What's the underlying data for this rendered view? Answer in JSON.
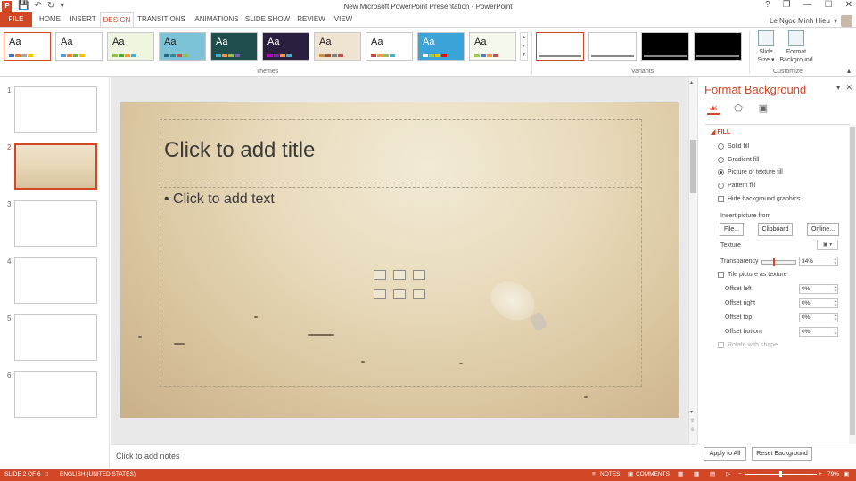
{
  "app": {
    "window_title": "New Microsoft PowerPoint Presentation - PowerPoint",
    "logo_letter": "P"
  },
  "qat": {
    "save_icon": "save-icon",
    "undo_icon": "undo-icon",
    "redo_icon": "redo-icon"
  },
  "window_controls": {
    "help": "?",
    "restore_ribbon": "❐",
    "minimize": "—",
    "maximize": "☐",
    "close": "✕"
  },
  "tabs": [
    {
      "label": "FILE"
    },
    {
      "label": "HOME"
    },
    {
      "label": "INSERT"
    },
    {
      "label": "DESIGN"
    },
    {
      "label": "TRANSITIONS"
    },
    {
      "label": "ANIMATIONS"
    },
    {
      "label": "SLIDE SHOW"
    },
    {
      "label": "REVIEW"
    },
    {
      "label": "VIEW"
    }
  ],
  "user": {
    "name": "Le Ngoc Minh Hieu"
  },
  "ribbon": {
    "themes_label": "Themes",
    "variants_label": "Variants",
    "customize_label": "Customize",
    "theme_sample": "Aa",
    "slide_size_label": "Slide Size",
    "slide_size_line1": "Slide",
    "slide_size_line2": "Size ▾",
    "format_background_line1": "Format",
    "format_background_line2": "Background"
  },
  "theme_colors": {
    "accent": "#d24726",
    "themes": [
      {
        "bg": "#ffffff",
        "bars": [
          "#4472c4",
          "#ed7d31",
          "#a5a5a5",
          "#ffc000"
        ]
      },
      {
        "bg": "#ffffff",
        "bars": [
          "#5b9bd5",
          "#ed7d31",
          "#70ad47",
          "#ffc000"
        ]
      },
      {
        "bg": "#eef5e0",
        "bars": [
          "#8cc63f",
          "#4ea72e",
          "#f79646",
          "#4bacc6"
        ]
      },
      {
        "bg": "#7dc3d8",
        "bars": [
          "#1f6b7a",
          "#2a8aa1",
          "#c0504d",
          "#9bbb59"
        ]
      },
      {
        "bg": "#1f4e4e",
        "bars": [
          "#4bacc6",
          "#f79646",
          "#9bbb59",
          "#8064a2"
        ]
      },
      {
        "bg": "#2b1f3f",
        "bars": [
          "#c000c0",
          "#7030a0",
          "#f79646",
          "#4bacc6"
        ]
      },
      {
        "bg": "#efe4d2",
        "bars": [
          "#d38c3c",
          "#a0522d",
          "#7f7f7f",
          "#c0504d"
        ]
      },
      {
        "bg": "#ffffff",
        "bars": [
          "#c0504d",
          "#f79646",
          "#9bbb59",
          "#4bacc6"
        ]
      },
      {
        "bg": "#3aa3d8",
        "bars": [
          "#ffffff",
          "#92d050",
          "#ffc000",
          "#ff0000"
        ]
      },
      {
        "bg": "#f4f8ec",
        "bars": [
          "#92d050",
          "#4f81bd",
          "#f79646",
          "#c0504d"
        ]
      }
    ],
    "variants": [
      "#ffffff",
      "#ffffff",
      "#000000",
      "#000000"
    ]
  },
  "slides": [
    {
      "number": "1"
    },
    {
      "number": "2"
    },
    {
      "number": "3"
    },
    {
      "number": "4"
    },
    {
      "number": "5"
    },
    {
      "number": "6"
    }
  ],
  "slide": {
    "title_placeholder": "Click to add title",
    "body_placeholder": "• Click to add text"
  },
  "notes": {
    "placeholder": "Click to add notes"
  },
  "format_background": {
    "title": "Format Background",
    "fill_header": "◢ FILL",
    "options": {
      "solid": "Solid fill",
      "gradient": "Gradient fill",
      "picture": "Picture or texture fill",
      "pattern": "Pattern fill",
      "hide_graphics": "Hide background graphics"
    },
    "insert_picture_from": "Insert picture from",
    "file_btn": "File...",
    "clipboard_btn": "Clipboard",
    "online_btn": "Online...",
    "texture_label": "Texture",
    "transparency_label": "Transparency",
    "transparency_value": "34%",
    "tile_label": "Tile picture as texture",
    "offset_left_label": "Offset left",
    "offset_left": "0%",
    "offset_right_label": "Offset right",
    "offset_right": "0%",
    "offset_top_label": "Offset top",
    "offset_top": "0%",
    "offset_bottom_label": "Offset bottom",
    "offset_bottom": "0%",
    "rotate_label": "Rotate with shape",
    "apply_all": "Apply to All",
    "reset": "Reset Background"
  },
  "status_bar": {
    "slide_info": "SLIDE 2 OF 6",
    "language": "ENGLISH (UNITED STATES)",
    "notes": "NOTES",
    "comments": "COMMENTS",
    "zoom": "79%"
  }
}
